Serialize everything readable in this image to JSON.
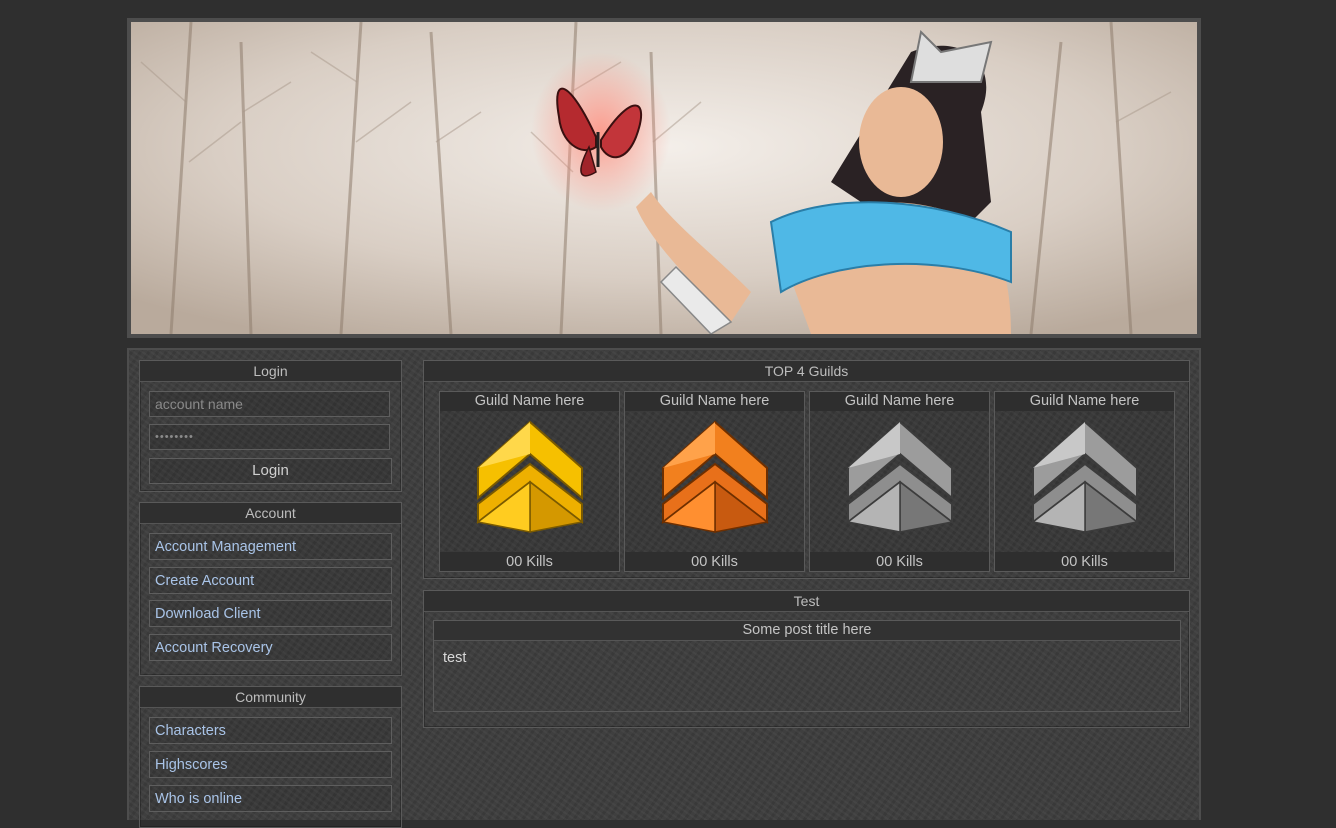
{
  "login": {
    "title": "Login",
    "account_placeholder": "account name",
    "password_value": "••••••••",
    "button_label": "Login"
  },
  "account": {
    "title": "Account",
    "links": [
      "Account Management",
      "Create Account",
      "Download Client",
      "Account Recovery"
    ]
  },
  "community": {
    "title": "Community",
    "links": [
      "Characters",
      "Highscores",
      "Who is online"
    ]
  },
  "guilds": {
    "title": "TOP 4 Guilds",
    "items": [
      {
        "name": "Guild Name here",
        "kills": "00 Kills",
        "emblem": "gold-chevron-emblem"
      },
      {
        "name": "Guild Name here",
        "kills": "00 Kills",
        "emblem": "orange-chevron-emblem"
      },
      {
        "name": "Guild Name here",
        "kills": "00 Kills",
        "emblem": "silver-chevron-emblem"
      },
      {
        "name": "Guild Name here",
        "kills": "00 Kills",
        "emblem": "silver-chevron-emblem"
      }
    ]
  },
  "news": {
    "title": "Test",
    "post_title": "Some post title here",
    "post_body": "test"
  },
  "colors": {
    "background": "#2f2f2f",
    "link": "#a9c4e8",
    "gold": "#f2b600",
    "orange": "#f07a1a",
    "silver": "#9a9a9a"
  }
}
